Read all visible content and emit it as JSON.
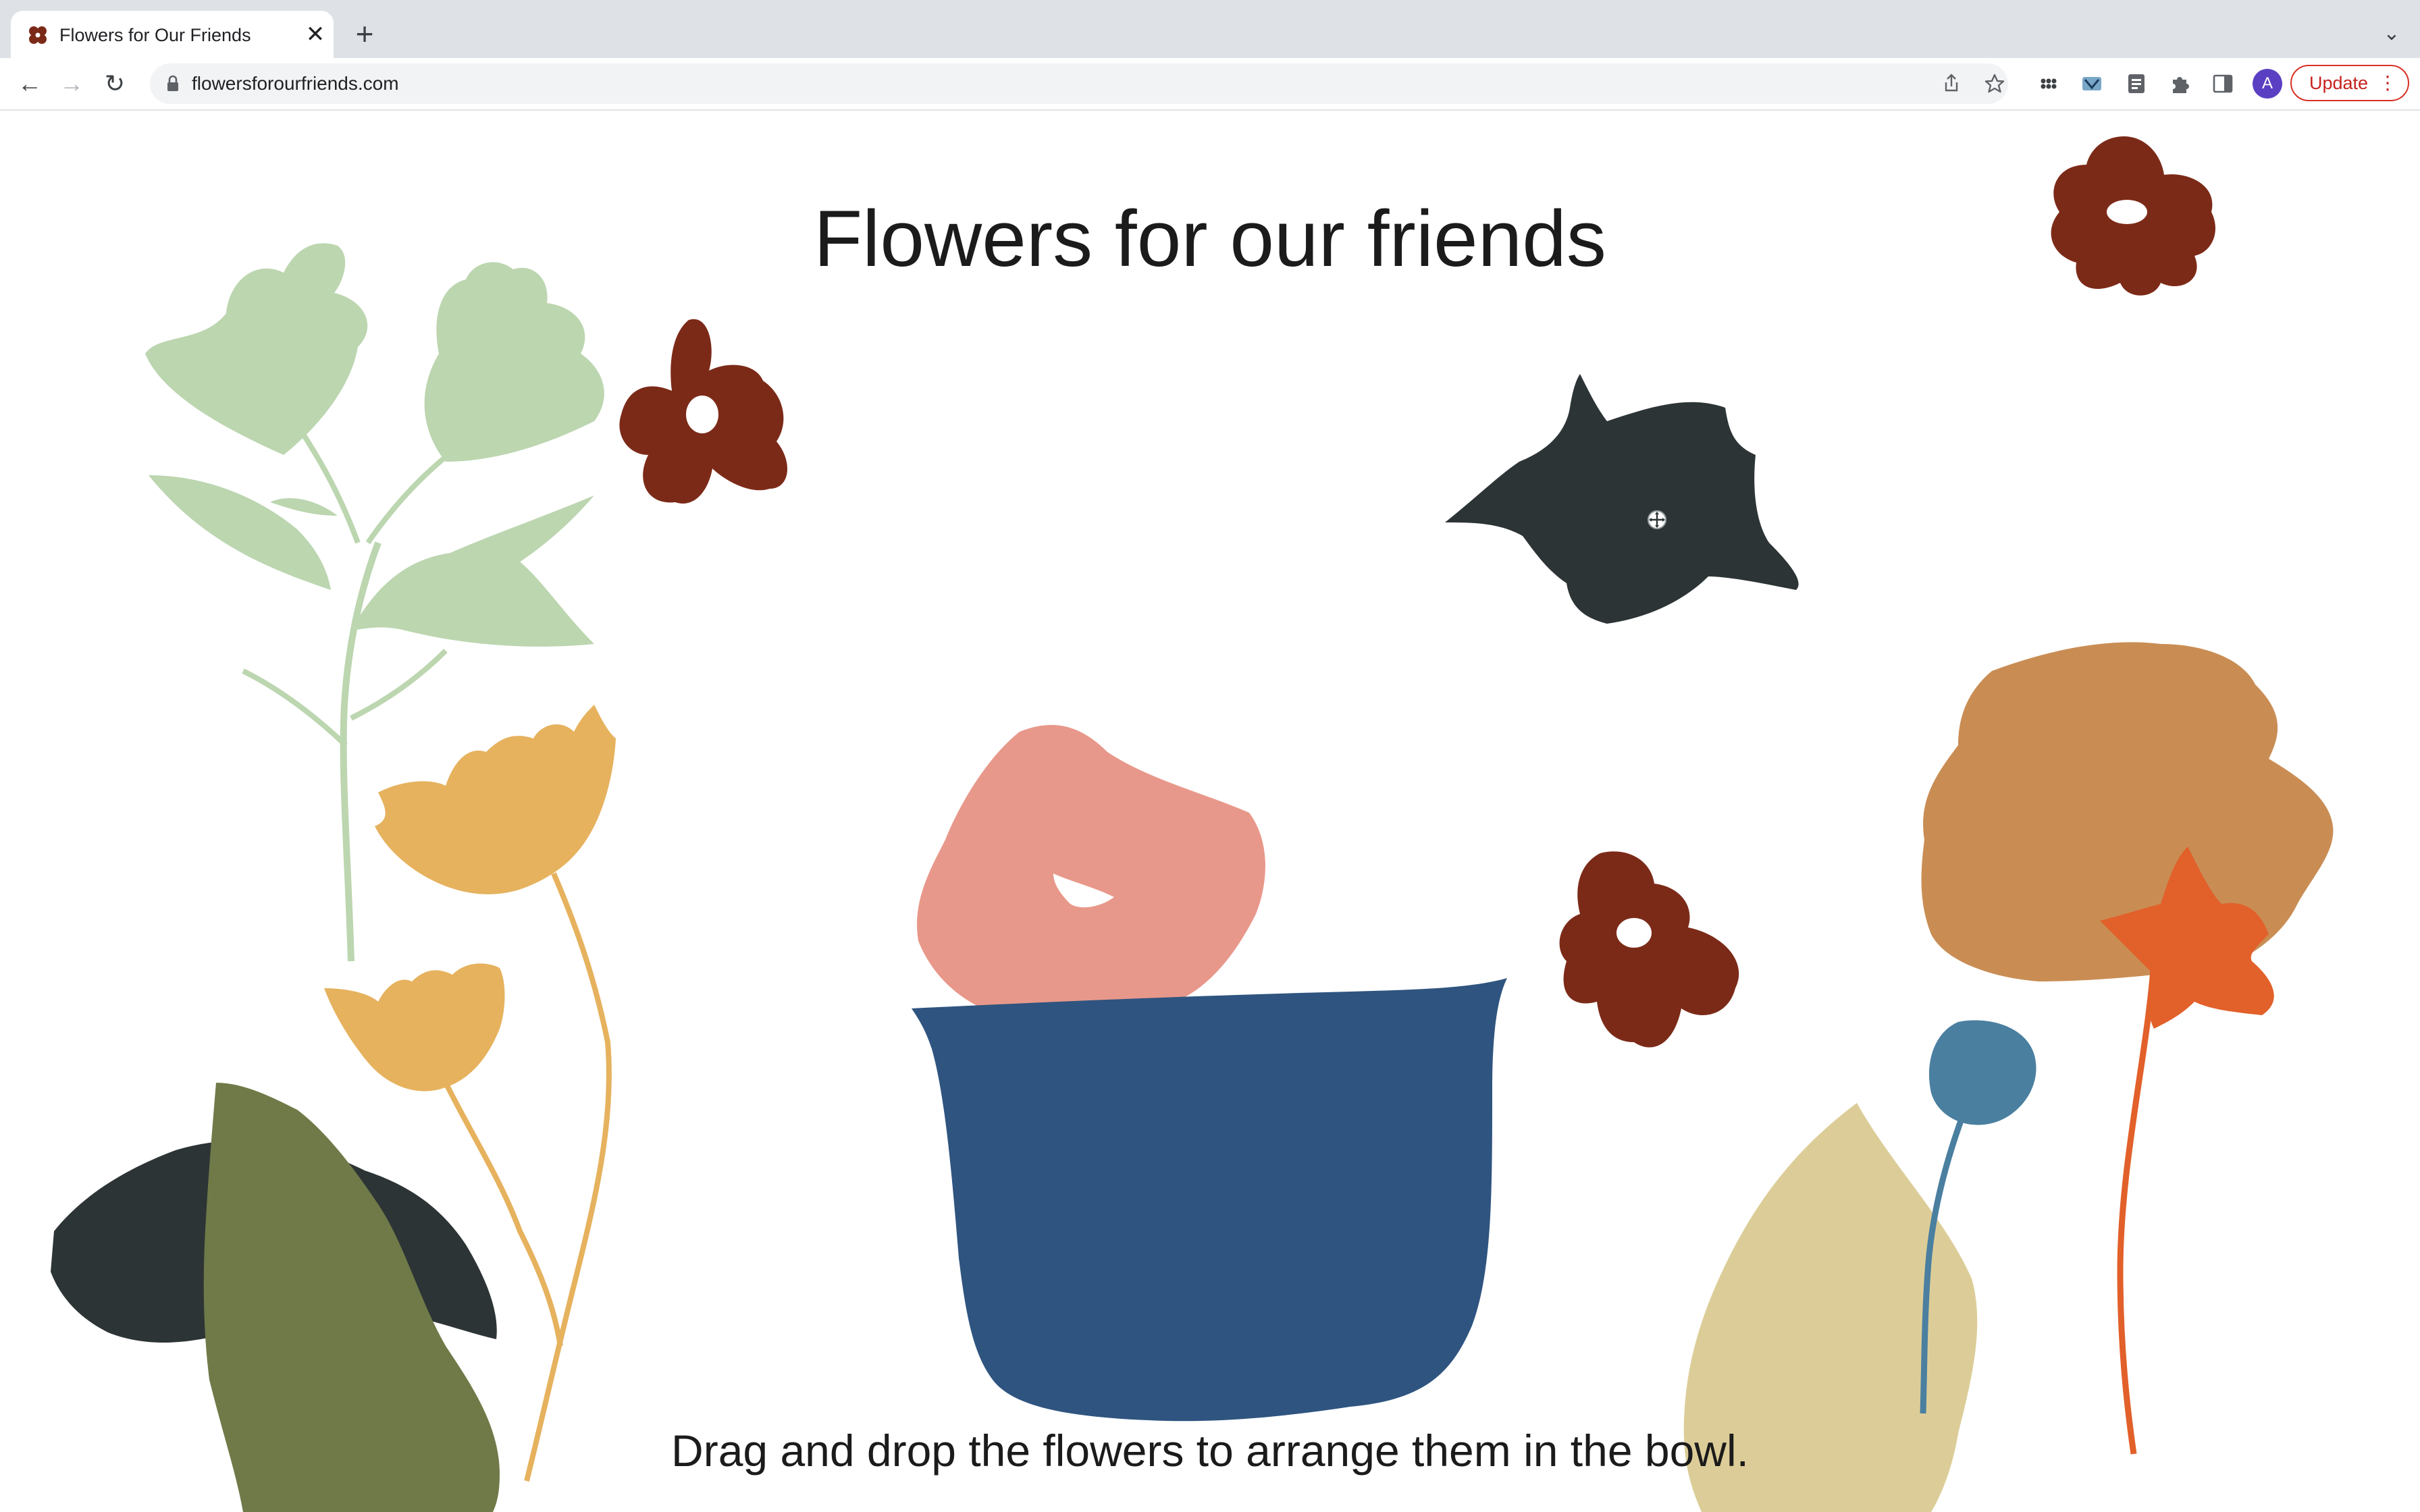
{
  "browser": {
    "tab": {
      "title": "Flowers for Our Friends",
      "close_glyph": "✕",
      "favicon": "flower-favicon"
    },
    "new_tab_glyph": "+",
    "tab_menu_glyph": "⌄",
    "nav": {
      "back": "←",
      "forward": "→",
      "reload": "↻"
    },
    "omnibox": {
      "url": "flowersforourfriends.com"
    },
    "profile_initial": "A",
    "update_label": "Update",
    "update_menu_glyph": "⋮"
  },
  "page": {
    "title": "Flowers for our friends",
    "instruction": "Drag and drop the flowers to arrange them in the bowl."
  },
  "colors": {
    "bowl": "#2f5480",
    "peach_flower": "#e8988a",
    "dark_red_flower": "#7c2a18",
    "charcoal_flower": "#2d3436",
    "sage_leaves": "#bcd6b0",
    "mustard_flower": "#e6b25e",
    "olive_leaf": "#6f7a48",
    "tan_bloom": "#c98d54",
    "orange_flower": "#e2602a",
    "blue_bud": "#4a7fa0",
    "sand_leaf": "#dccd98"
  }
}
